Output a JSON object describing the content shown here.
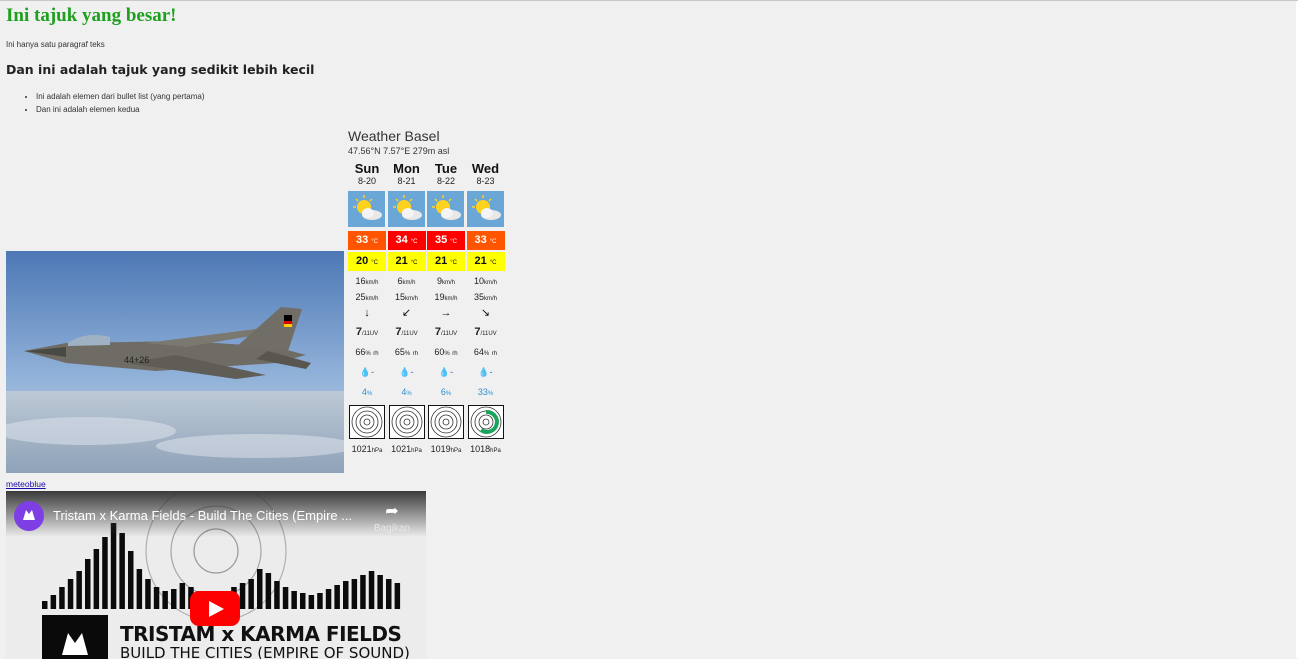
{
  "page": {
    "heading": "Ini tajuk yang besar!",
    "paragraph": "Ini hanya satu paragraf teks",
    "subheading": "Dan ini adalah tajuk yang sedikit lebih kecil",
    "bullets": [
      "Ini adalah elemen dari bullet list (yang pertama)",
      "Dan ini adalah elemen kedua"
    ],
    "meteo_link": "meteoblue"
  },
  "weather": {
    "title": "Weather Basel",
    "coords": "47.56°N 7.57°E 279m asl",
    "temp_unit": "°C",
    "wind_unit": "km/h",
    "uv_unit": "/11UV",
    "humidity_unit": "%",
    "humidity_suffix": "rh",
    "precip_value": "-",
    "prob_unit": "%",
    "pressure_unit": "hPa",
    "days": [
      {
        "name": "Sun",
        "date": "8-20",
        "tmax": "33",
        "tmin": "20",
        "wind": "16",
        "gust": "25",
        "arrow": "↓",
        "uv": "7",
        "hum": "66",
        "prob": "4",
        "press": "1021",
        "maxcolor": "#ff5500"
      },
      {
        "name": "Mon",
        "date": "8-21",
        "tmax": "34",
        "tmin": "21",
        "wind": "6",
        "gust": "15",
        "arrow": "↙",
        "uv": "7",
        "hum": "65",
        "prob": "4",
        "press": "1021",
        "maxcolor": "#ff0000"
      },
      {
        "name": "Tue",
        "date": "8-22",
        "tmax": "35",
        "tmin": "21",
        "wind": "9",
        "gust": "19",
        "arrow": "→",
        "uv": "7",
        "hum": "60",
        "prob": "6",
        "press": "1019",
        "maxcolor": "#ff0000"
      },
      {
        "name": "Wed",
        "date": "8-23",
        "tmax": "33",
        "tmin": "21",
        "wind": "10",
        "gust": "35",
        "arrow": "↘",
        "uv": "7",
        "hum": "64",
        "prob": "33",
        "press": "1018",
        "maxcolor": "#ff5500"
      }
    ]
  },
  "video": {
    "title": "Tristam x Karma Fields - Build The Cities (Empire ...",
    "share_label": "Bagikan",
    "thumb_line1": "TRISTAM x KARMA FIELDS",
    "thumb_line2": "BUILD THE CITIES (EMPIRE OF SOUND)"
  }
}
